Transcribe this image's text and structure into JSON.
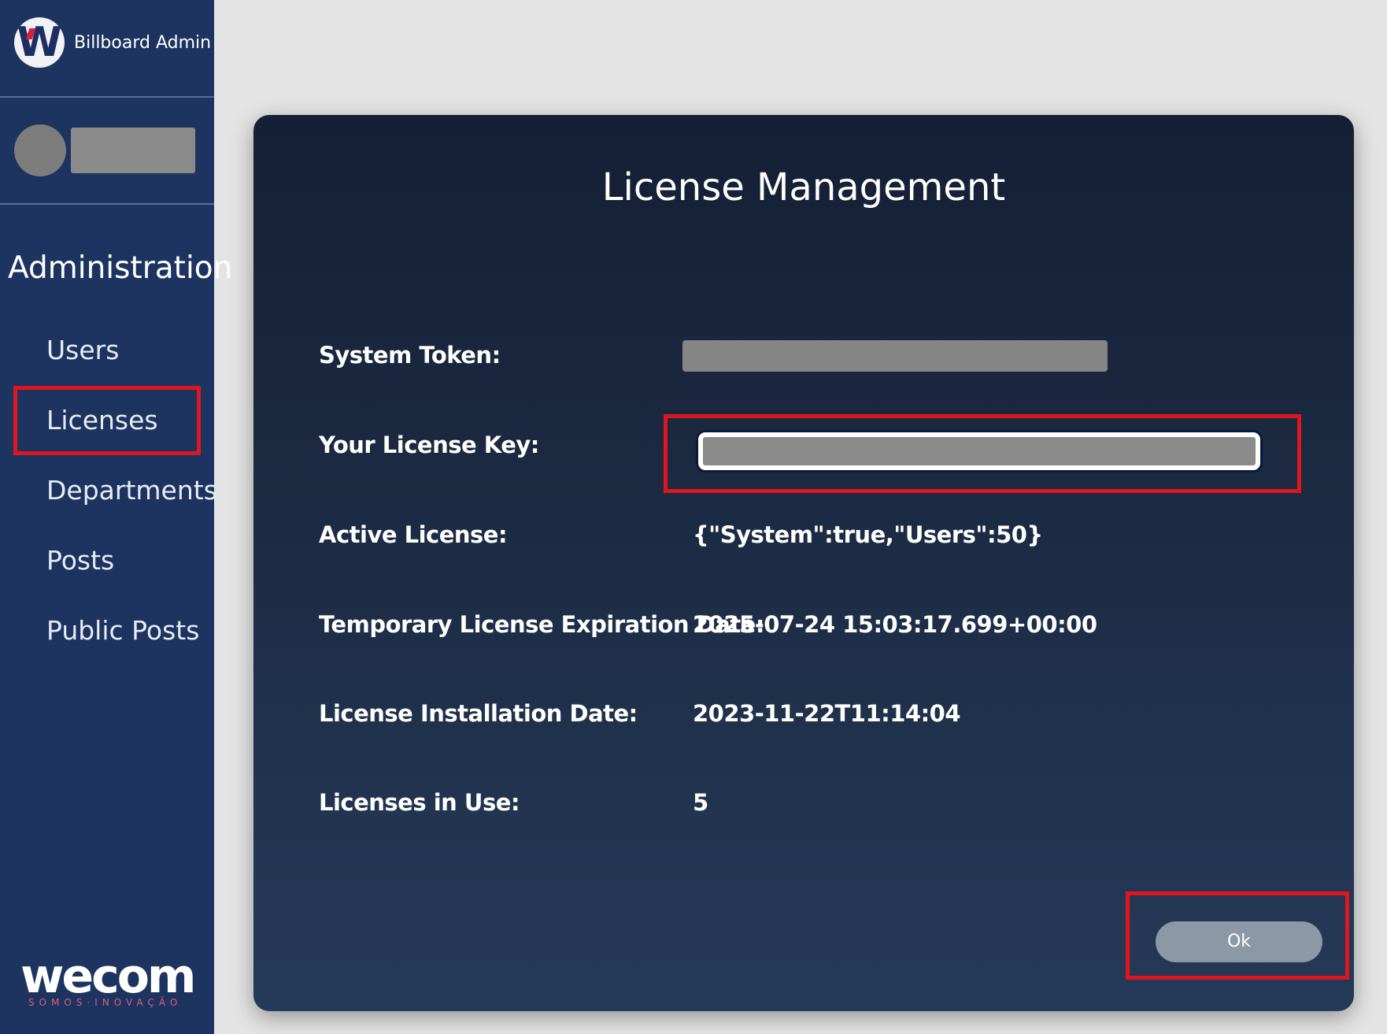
{
  "sidebar": {
    "brand_name": "Billboard Admin",
    "logo_letter": "W",
    "section_title": "Administration",
    "items": [
      {
        "label": "Users"
      },
      {
        "label": "Licenses"
      },
      {
        "label": "Departments"
      },
      {
        "label": "Posts"
      },
      {
        "label": "Public Posts"
      }
    ],
    "footer_brand": "wecom",
    "footer_tagline": "SOMOS·INOVAÇÃO"
  },
  "modal": {
    "title": "License Management",
    "rows": [
      {
        "label": "System Token:"
      },
      {
        "label": "Your License Key:"
      },
      {
        "label": "Active License:",
        "value": "{\"System\":true,\"Users\":50}"
      },
      {
        "label": "Temporary License Expiration Date:",
        "value": "2025-07-24 15:03:17.699+00:00"
      },
      {
        "label": "License Installation Date:",
        "value": "2023-11-22T11:14:04"
      },
      {
        "label": "Licenses in Use:",
        "value": "5"
      }
    ],
    "ok_label": "Ok"
  },
  "colors": {
    "sidebar_bg": "#1d3461",
    "highlight": "#e0161f",
    "ok_button": "#8c98a6"
  }
}
